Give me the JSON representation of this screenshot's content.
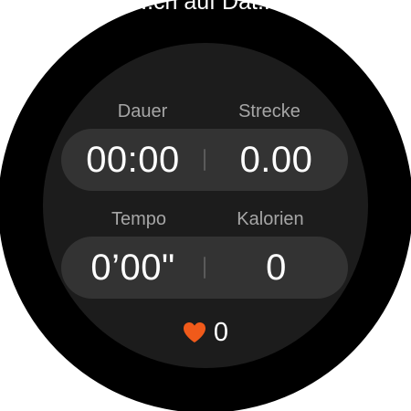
{
  "header": {
    "banner_text": "...ch auf Dat..."
  },
  "stats": {
    "duration": {
      "label": "Dauer",
      "value": "00:00"
    },
    "distance": {
      "label": "Strecke",
      "value": "0.00"
    },
    "pace": {
      "label": "Tempo",
      "value": "0’00\""
    },
    "calories": {
      "label": "Kalorien",
      "value": "0"
    }
  },
  "heart_rate": {
    "icon": "heart-icon",
    "value": "0",
    "color": "#f05a1a"
  },
  "colors": {
    "background": "#000000",
    "face": "#1c1c1c",
    "pill": "#333333",
    "label": "#a6a6a6",
    "value": "#ffffff"
  }
}
